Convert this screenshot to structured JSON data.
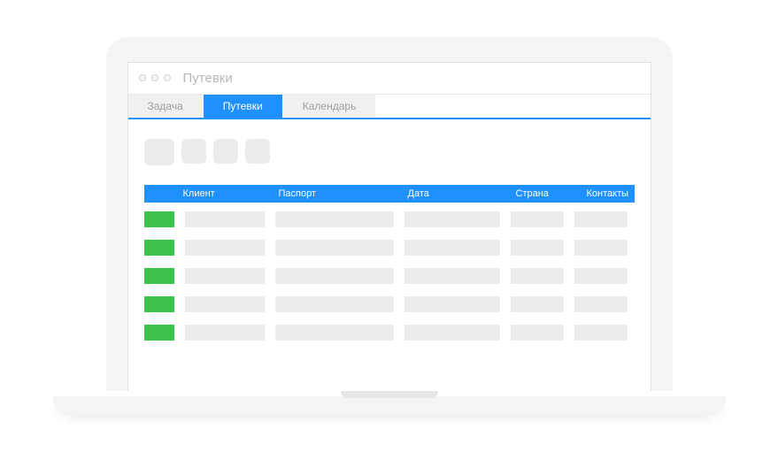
{
  "window": {
    "title": "Путевки"
  },
  "tabs": [
    {
      "label": "Задача",
      "active": false
    },
    {
      "label": "Путевки",
      "active": true
    },
    {
      "label": "Календарь",
      "active": false
    }
  ],
  "table": {
    "headers": {
      "client": "Клиент",
      "passport": "Паспорт",
      "date": "Дата",
      "country": "Страна",
      "contacts": "Контакты"
    },
    "rows": [
      {
        "status": "green"
      },
      {
        "status": "green"
      },
      {
        "status": "green"
      },
      {
        "status": "green"
      },
      {
        "status": "green"
      }
    ]
  },
  "colors": {
    "accent": "#1e90ff",
    "status_ok": "#3ec14a",
    "placeholder": "#ececec"
  }
}
